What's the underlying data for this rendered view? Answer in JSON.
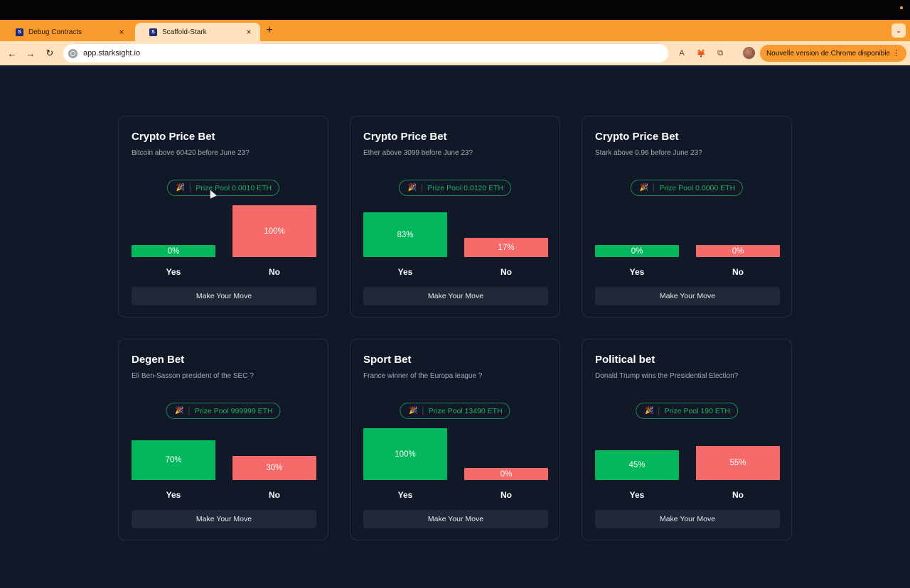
{
  "browser": {
    "tabs": [
      {
        "label": "Debug Contracts",
        "favicon": "scaffold-stark-icon",
        "active": false
      },
      {
        "label": "Scaffold-Stark",
        "favicon": "scaffold-stark-icon",
        "active": true
      }
    ],
    "url": "app.starksight.io",
    "update_notice": "Nouvelle version de Chrome disponible",
    "colors": {
      "accent": "#f99a2f",
      "toolbar": "#fde2bd"
    }
  },
  "page": {
    "colors": {
      "background": "#111827",
      "yes": "#03b85c",
      "no": "#f66a6a",
      "prize": "#21b15a"
    },
    "cards": [
      {
        "title": "Crypto Price Bet",
        "question": "Bitcoin above 60420 before June 23?",
        "prize_pool": "Prize Pool 0.0010 ETH",
        "yes_percent": 0,
        "no_percent": 100,
        "yes_text": "0%",
        "no_text": "100%",
        "yes_label": "Yes",
        "no_label": "No",
        "button_label": "Make Your Move"
      },
      {
        "title": "Crypto Price Bet",
        "question": "Ether above 3099 before June 23?",
        "prize_pool": "Prize Pool 0.0120 ETH",
        "yes_percent": 83,
        "no_percent": 17,
        "yes_text": "83%",
        "no_text": "17%",
        "yes_label": "Yes",
        "no_label": "No",
        "button_label": "Make Your Move"
      },
      {
        "title": "Crypto Price Bet",
        "question": "Stark above 0.96 before June 23?",
        "prize_pool": "Prize Pool 0.0000 ETH",
        "yes_percent": 0,
        "no_percent": 0,
        "yes_text": "0%",
        "no_text": "0%",
        "yes_label": "Yes",
        "no_label": "No",
        "button_label": "Make Your Move"
      },
      {
        "title": "Degen Bet",
        "question": "Eli Ben-Sasson president of the SEC ?",
        "prize_pool": "Prize Pool 999999 ETH",
        "yes_percent": 70,
        "no_percent": 30,
        "yes_text": "70%",
        "no_text": "30%",
        "yes_label": "Yes",
        "no_label": "No",
        "button_label": "Make Your Move"
      },
      {
        "title": "Sport Bet",
        "question": "France winner of the Europa league ?",
        "prize_pool": "Prize Pool 13490 ETH",
        "yes_percent": 100,
        "no_percent": 0,
        "yes_text": "100%",
        "no_text": "0%",
        "yes_label": "Yes",
        "no_label": "No",
        "button_label": "Make Your Move"
      },
      {
        "title": "Political bet",
        "question": "Donald Trump wins the Presidential Election?",
        "prize_pool": "Prize Pool 190 ETH",
        "yes_percent": 45,
        "no_percent": 55,
        "yes_text": "45%",
        "no_text": "55%",
        "yes_label": "Yes",
        "no_label": "No",
        "button_label": "Make Your Move"
      }
    ]
  }
}
